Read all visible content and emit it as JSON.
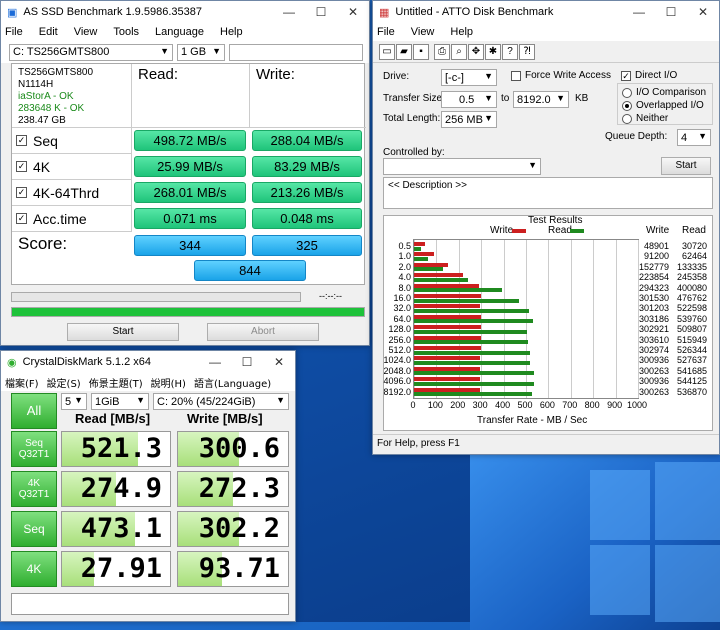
{
  "asssd": {
    "title": "AS SSD Benchmark 1.9.5986.35387",
    "menu": [
      "File",
      "Edit",
      "View",
      "Tools",
      "Language",
      "Help"
    ],
    "drive_select": "C: TS256GMTS800",
    "size_select": "1 GB",
    "info": {
      "model": "TS256GMTS800",
      "firmware": "N1114H",
      "driver": "iaStorA - OK",
      "alignment": "283648 K - OK",
      "capacity": "238.47 GB"
    },
    "col_read": "Read:",
    "col_write": "Write:",
    "rows": [
      {
        "label": "Seq",
        "read": "498.72 MB/s",
        "write": "288.04 MB/s"
      },
      {
        "label": "4K",
        "read": "25.99 MB/s",
        "write": "83.29 MB/s"
      },
      {
        "label": "4K-64Thrd",
        "read": "268.01 MB/s",
        "write": "213.26 MB/s"
      },
      {
        "label": "Acc.time",
        "read": "0.071 ms",
        "write": "0.048 ms"
      }
    ],
    "score_label": "Score:",
    "score_read": "344",
    "score_write": "325",
    "score_total": "844",
    "timer": "--:--:--",
    "progress_fraction": 1.0,
    "start_label": "Start",
    "abort_label": "Abort"
  },
  "atto": {
    "title": "Untitled - ATTO Disk Benchmark",
    "menu": [
      "File",
      "View",
      "Help"
    ],
    "drive_label": "Drive:",
    "drive_value": "[-c-]",
    "force_write_label": "Force Write Access",
    "direct_io_label": "Direct I/O",
    "transfer_size_label": "Transfer Size:",
    "transfer_from": "0.5",
    "transfer_to_label": "to",
    "transfer_to": "8192.0",
    "transfer_unit": "KB",
    "total_length_label": "Total Length:",
    "total_length": "256 MB",
    "io_comparison_label": "I/O Comparison",
    "overlapped_io_label": "Overlapped I/O",
    "neither_label": "Neither",
    "queue_depth_label": "Queue Depth:",
    "queue_depth": "4",
    "controlled_by_label": "Controlled by:",
    "start_label": "Start",
    "description": "<< Description >>",
    "results_title": "Test Results",
    "legend_write": "Write",
    "legend_read": "Read",
    "col_write": "Write",
    "col_read": "Read",
    "status": "For Help, press F1",
    "chart_data": {
      "type": "bar",
      "title": "Test Results",
      "xlabel": "Transfer Rate - MB / Sec",
      "xlim": [
        0,
        1000
      ],
      "x_ticks": [
        "0",
        "100",
        "200",
        "300",
        "400",
        "500",
        "600",
        "700",
        "800",
        "900",
        "1000"
      ],
      "categories": [
        "0.5",
        "1.0",
        "2.0",
        "4.0",
        "8.0",
        "16.0",
        "32.0",
        "64.0",
        "128.0",
        "256.0",
        "512.0",
        "1024.0",
        "2048.0",
        "4096.0",
        "8192.0"
      ],
      "series": [
        {
          "name": "Write",
          "color": "#cc1f1f",
          "values": [
            48901,
            91200,
            152779,
            223854,
            294323,
            301530,
            301203,
            303186,
            302921,
            303610,
            302974,
            300936,
            300263,
            300936,
            300263
          ]
        },
        {
          "name": "Read",
          "color": "#1f8a1f",
          "values": [
            30720,
            62464,
            133335,
            245358,
            400080,
            476762,
            522598,
            539760,
            509807,
            515949,
            526344,
            527637,
            541685,
            544125,
            536870
          ]
        }
      ]
    }
  },
  "cdm": {
    "title": "CrystalDiskMark 5.1.2 x64",
    "menu": [
      "檔案(F)",
      "設定(S)",
      "佈景主題(T)",
      "說明(H)",
      "語言(Language)"
    ],
    "all_label": "All",
    "count": "5",
    "size": "1GiB",
    "drive": "C: 20% (45/224GiB)",
    "col_read": "Read [MB/s]",
    "col_write": "Write [MB/s]",
    "rows": [
      {
        "l1": "Seq",
        "l2": "Q32T1",
        "read": "521.3",
        "write": "300.6",
        "read_frac": 0.7,
        "write_frac": 0.55
      },
      {
        "l1": "4K",
        "l2": "Q32T1",
        "read": "274.9",
        "write": "272.3",
        "read_frac": 0.5,
        "write_frac": 0.5
      },
      {
        "l1": "Seq",
        "l2": "",
        "read": "473.1",
        "write": "302.2",
        "read_frac": 0.68,
        "write_frac": 0.55
      },
      {
        "l1": "4K",
        "l2": "",
        "read": "27.91",
        "write": "93.71",
        "read_frac": 0.3,
        "write_frac": 0.4
      }
    ]
  }
}
